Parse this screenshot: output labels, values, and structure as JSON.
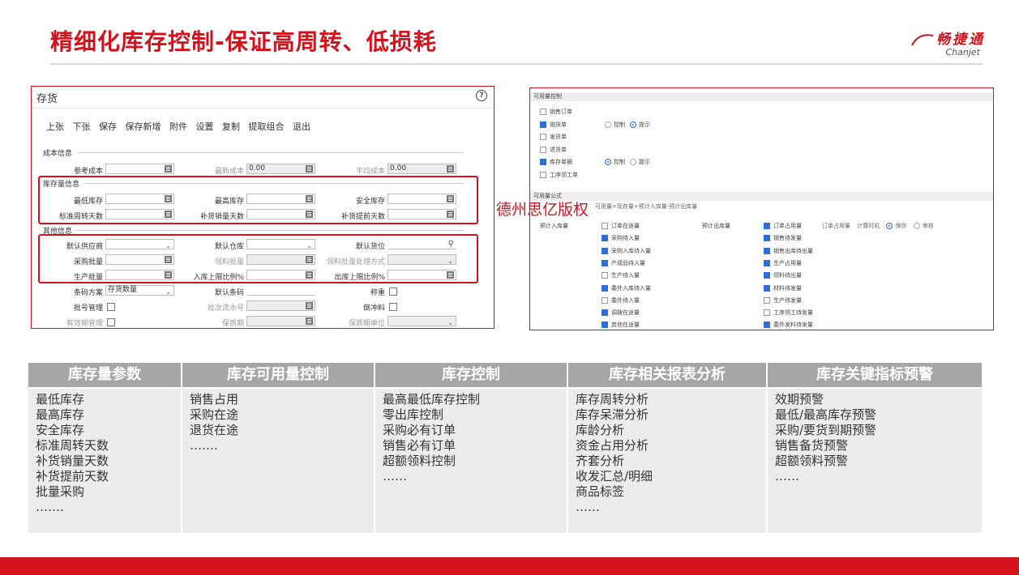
{
  "header": {
    "title": "精细化库存控制-保证高周转、低损耗",
    "logo_cn": "畅捷通",
    "logo_en": "Chanjet"
  },
  "left_panel": {
    "title": "存货",
    "toolbar": [
      "上张",
      "下张",
      "保存",
      "保存新增",
      "附件",
      "设置",
      "复制",
      "提取组合",
      "退出"
    ],
    "sections": {
      "cost": "成本信息",
      "stock": "库存量信息",
      "other": "其他信息"
    },
    "cost_fields": {
      "ref_cost": "参考成本",
      "latest_cost": "最新成本",
      "latest_cost_value": "0.00",
      "avg_cost": "平均成本",
      "avg_cost_value": "0.00"
    },
    "stock_fields": {
      "min_stock": "最低库存",
      "max_stock": "最高库存",
      "safety_stock": "安全库存",
      "std_turnover_days": "标准周转天数",
      "replenish_sales_days": "补货销量天数",
      "replenish_lead_days": "补货提前天数"
    },
    "other_fields": {
      "default_supplier": "默认供应商",
      "default_warehouse": "默认仓库",
      "default_location": "默认货位",
      "purchase_batch": "采购批量",
      "issue_batch": "领料批量",
      "issue_batch_method": "领料批量处理方式",
      "production_batch": "生产批量",
      "inbound_limit_ratio": "入库上限比例%",
      "outbound_limit_ratio": "出库上限比例%",
      "barcode_scheme": "条码方案",
      "barcode_scheme_value": "存货数量",
      "default_barcode": "默认条码",
      "weighing": "称重",
      "batch_management": "批号管理",
      "batch_serial": "批次流水号",
      "backflush": "倒冲料",
      "expiry_management": "有效期管理",
      "shelf_life": "保质期",
      "shelf_life_unit": "保质期单位"
    }
  },
  "right_panel": {
    "section1": "可用量控制",
    "rows1": [
      {
        "label": "销售订单",
        "checked": false,
        "radios": []
      },
      {
        "label": "销货单",
        "checked": true,
        "radios": [
          {
            "label": "控制",
            "on": false
          },
          {
            "label": "提示",
            "on": true
          }
        ]
      },
      {
        "label": "发货单",
        "checked": false,
        "radios": []
      },
      {
        "label": "退货单",
        "checked": false,
        "radios": []
      },
      {
        "label": "库存单据",
        "checked": true,
        "radios": [
          {
            "label": "控制",
            "on": true
          },
          {
            "label": "提示",
            "on": false
          }
        ]
      },
      {
        "label": "工序领工单",
        "checked": false,
        "radios": []
      }
    ],
    "section2": "可用量公式",
    "formula_hint": "可用量=现存量+预计入库量-预计出库量",
    "inbound_title": "预计入库量",
    "outbound_title": "预计出库量",
    "outbound_extra": [
      "订单占用量",
      "计算时机",
      "保存",
      "审核"
    ],
    "inbound_items": [
      {
        "label": "订单在途量",
        "checked": false
      },
      {
        "label": "采购待入量",
        "checked": true
      },
      {
        "label": "采购入库待入量",
        "checked": true
      },
      {
        "label": "产成品待入量",
        "checked": true
      },
      {
        "label": "生产待入量",
        "checked": false
      },
      {
        "label": "委外入库待入量",
        "checked": true
      },
      {
        "label": "委外待入量",
        "checked": false
      },
      {
        "label": "调拨在途量",
        "checked": true
      },
      {
        "label": "其他在途量",
        "checked": true
      }
    ],
    "outbound_items": [
      {
        "label": "订单占用量",
        "checked": true
      },
      {
        "label": "销售待发量",
        "checked": true
      },
      {
        "label": "销售出库待出量",
        "checked": true
      },
      {
        "label": "生产占用量",
        "checked": true
      },
      {
        "label": "领料待出量",
        "checked": true
      },
      {
        "label": "材料待发量",
        "checked": true
      },
      {
        "label": "生产待发量",
        "checked": false
      },
      {
        "label": "工序领工待发量",
        "checked": false
      },
      {
        "label": "委外发料待发量",
        "checked": true
      }
    ]
  },
  "watermark": "德州思亿版权",
  "table": {
    "columns": [
      {
        "header": "库存量参数",
        "items": [
          "最低库存",
          "最高库存",
          "安全库存",
          "标准周转天数",
          "补货销量天数",
          "补货提前天数",
          "批量采购",
          "……."
        ]
      },
      {
        "header": "库存可用量控制",
        "items": [
          "销售占用",
          "采购在途",
          "退货在途",
          "……."
        ]
      },
      {
        "header": "库存控制",
        "items": [
          "最高最低库存控制",
          "零出库控制",
          "采购必有订单",
          "销售必有订单",
          "超额领料控制",
          "……"
        ]
      },
      {
        "header": "库存相关报表分析",
        "items": [
          "库存周转分析",
          "库存呆滞分析",
          "库龄分析",
          "资金占用分析",
          "齐套分析",
          "收发汇总/明细",
          "商品标签",
          "……"
        ]
      },
      {
        "header": "库存关键指标预警",
        "items": [
          "效期预警",
          "最低/最高库存预警",
          "采购/要货到期预警",
          "销售备货预警",
          "超额领料预警",
          "……"
        ]
      }
    ]
  },
  "colors": {
    "brand_red": "#d3121b",
    "header_grey": "#a6a6a6",
    "cell_grey": "#ececec",
    "check_blue": "#2d6fd6"
  }
}
